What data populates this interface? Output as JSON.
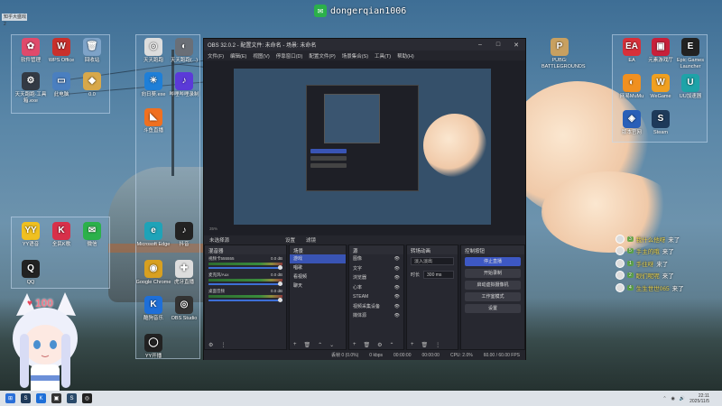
{
  "top_left_tab": "知乎大盛戏2",
  "wechat_id": "dongerqian1006",
  "desktop_icons_left": [
    {
      "label": "软件管理",
      "color": "#e04a6b",
      "glyph": "✿"
    },
    {
      "label": "WPS Office",
      "color": "#c9302c",
      "glyph": "W"
    },
    {
      "label": "回收站",
      "color": "#7ea3c8",
      "glyph": "🗑"
    },
    {
      "label": "天天跑跑·工具箱.exe",
      "color": "#333a44",
      "glyph": "⚙"
    },
    {
      "label": "此电脑",
      "color": "#4a7fc0",
      "glyph": "▭"
    },
    {
      "label": "0.0",
      "color": "#d8a84a",
      "glyph": "◆"
    },
    {
      "label": "YY语音",
      "color": "#f0c020",
      "glyph": "YY"
    },
    {
      "label": "全民K歌",
      "color": "#d8304a",
      "glyph": "K"
    },
    {
      "label": "微信",
      "color": "#2bb14a",
      "glyph": "✉"
    },
    {
      "label": "QQ",
      "color": "#222",
      "glyph": "Q"
    }
  ],
  "desktop_icons_mid": [
    {
      "label": "天天跑跑",
      "color": "#ddd",
      "glyph": "◎"
    },
    {
      "label": "天天跑跑(...)",
      "color": "#6a6f77",
      "glyph": "◐"
    },
    {
      "label": "向日葵.exe",
      "color": "#1e7fd8",
      "glyph": "☀"
    },
    {
      "label": "哔哩哔哩录制",
      "color": "#5b3ad8",
      "glyph": "♪"
    },
    {
      "label": "斗鱼直播",
      "color": "#f07020",
      "glyph": "◣"
    },
    {
      "label": "Microsoft Edge",
      "color": "#1fa3b8",
      "glyph": "e"
    },
    {
      "label": "抖音",
      "color": "#222",
      "glyph": "♪"
    },
    {
      "label": "Google Chrome",
      "color": "#d8a020",
      "glyph": "◉"
    },
    {
      "label": "虎牙直播",
      "color": "#ddd",
      "glyph": "✚"
    },
    {
      "label": "酷狗音乐",
      "color": "#1e6fd8",
      "glyph": "K"
    },
    {
      "label": "OBS Studio",
      "color": "#333",
      "glyph": "◎"
    },
    {
      "label": "YY开播",
      "color": "#222",
      "glyph": "◯"
    }
  ],
  "desktop_icons_right": [
    {
      "label": "PUBG: BATTLEGROUNDS",
      "color": "#c8a060",
      "glyph": "P"
    },
    {
      "label": "EA",
      "color": "#d8303a",
      "glyph": "EA"
    },
    {
      "label": "元素游戏厅",
      "color": "#c8203a",
      "glyph": "▣"
    },
    {
      "label": "Epic Games Launcher",
      "color": "#222",
      "glyph": "E"
    },
    {
      "label": "网易MuMu",
      "color": "#f09020",
      "glyph": "◐"
    },
    {
      "label": "WeGame",
      "color": "#f0a020",
      "glyph": "W"
    },
    {
      "label": "UU加速器",
      "color": "#1ea3a8",
      "glyph": "U"
    },
    {
      "label": "版本官网",
      "color": "#2a5fb8",
      "glyph": "◈"
    },
    {
      "label": "Steam",
      "color": "#1e3a5a",
      "glyph": "S"
    }
  ],
  "obs": {
    "title": "OBS 32.0.2 - 配置文件: 未命名 - 场景: 未命名",
    "menu": [
      "文件(F)",
      "编辑(E)",
      "视图(V)",
      "停靠窗口(D)",
      "配置文件(P)",
      "场景集合(S)",
      "工具(T)",
      "帮助(H)"
    ],
    "preview_status": "35%",
    "top_row": {
      "unselected": "未选择源",
      "properties": "设置",
      "filters": "滤镜"
    },
    "docks": {
      "mixer": "混音器",
      "scenes": "场景",
      "sources": "源",
      "transitions": "转场动画",
      "controls": "控制按钮"
    },
    "mixer_channels": [
      {
        "name": "视频卡555555",
        "db": "0.0 dB"
      },
      {
        "name": "麦克风/Aux",
        "db": "0.0 dB"
      },
      {
        "name": "桌面音频",
        "db": "0.0 dB"
      }
    ],
    "scenes": [
      "游戏",
      "唱歌",
      "看视频",
      "聊天"
    ],
    "selected_scene": "游戏",
    "sources": [
      "图像",
      "文字",
      "浏览器",
      "心率",
      "STEAM",
      "视频采集设备",
      "媒体源"
    ],
    "transition": {
      "type": "淡入淡出",
      "duration_label": "时长",
      "duration": "300 ms"
    },
    "controls": [
      "停止直播",
      "开始录制",
      "启动虚拟摄像机",
      "工作室模式",
      "设置"
    ],
    "status": {
      "frames": "丢帧 0 (0.0%)",
      "bitrate": "0 kbps",
      "stream_time": "00:00:00",
      "rec_time": "00:00:00",
      "cpu": "CPU: 2.0%",
      "fps": "60.00 / 60.00 FPS"
    }
  },
  "chat": [
    {
      "name": "我什么他呀",
      "text": "来了",
      "badge": "3"
    },
    {
      "name": "手主的哦",
      "text": "来了",
      "badge": "5"
    },
    {
      "name": "手住呀",
      "text": "来了",
      "badge": "1"
    },
    {
      "name": "眼们呢呢",
      "text": "来了",
      "badge": "2"
    },
    {
      "name": "生生世世065",
      "text": "来了",
      "badge": "4"
    }
  ],
  "hearts": "100",
  "clock": {
    "time": "22:11",
    "date": "2025/11/5"
  }
}
